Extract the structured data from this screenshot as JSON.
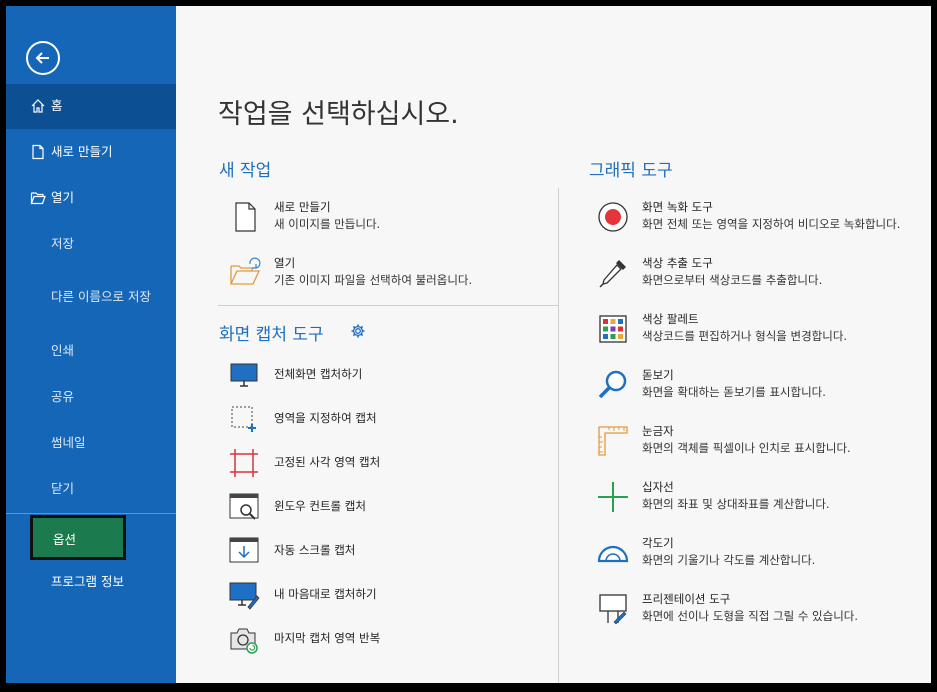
{
  "sidebar": {
    "items": [
      {
        "label": "홈"
      },
      {
        "label": "새로 만들기"
      },
      {
        "label": "열기"
      },
      {
        "label": "저장"
      },
      {
        "label": "다른 이름으로 저장"
      },
      {
        "label": "인쇄"
      },
      {
        "label": "공유"
      },
      {
        "label": "썸네일"
      },
      {
        "label": "닫기"
      },
      {
        "label": "옵션"
      },
      {
        "label": "프로그램 정보"
      }
    ]
  },
  "main": {
    "title": "작업을 선택하십시오.",
    "new_task": {
      "title": "새 작업",
      "items": [
        {
          "title": "새로 만들기",
          "desc": "새 이미지를 만듭니다."
        },
        {
          "title": "열기",
          "desc": "기존 이미지 파일을 선택하여 불러옵니다."
        }
      ]
    },
    "capture": {
      "title": "화면 캡처 도구",
      "items": [
        {
          "label": "전체화면 캡처하기"
        },
        {
          "label": "영역을 지정하여 캡처"
        },
        {
          "label": "고정된 사각 영역 캡처"
        },
        {
          "label": "윈도우 컨트롤 캡처"
        },
        {
          "label": "자동 스크롤 캡처"
        },
        {
          "label": "내 마음대로 캡처하기"
        },
        {
          "label": "마지막 캡처 영역 반복"
        }
      ]
    },
    "graphic": {
      "title": "그래픽 도구",
      "items": [
        {
          "title": "화면 녹화 도구",
          "desc": "화면 전체 또는 영역을 지정하여 비디오로 녹화합니다."
        },
        {
          "title": "색상 추출 도구",
          "desc": "화면으로부터 색상코드를 추출합니다."
        },
        {
          "title": "색상 팔레트",
          "desc": "색상코드를 편집하거나 형식을 변경합니다."
        },
        {
          "title": "돋보기",
          "desc": "화면을 확대하는 돋보기를 표시합니다."
        },
        {
          "title": "눈금자",
          "desc": "화면의 객체를 픽셀이나 인치로 표시합니다."
        },
        {
          "title": "십자선",
          "desc": "화면의 좌표 및 상대좌표를 계산합니다."
        },
        {
          "title": "각도기",
          "desc": "화면의 기울기나 각도를 계산합니다."
        },
        {
          "title": "프리젠테이션 도구",
          "desc": "화면에 선이나 도형을 직접 그릴 수 있습니다."
        }
      ]
    }
  },
  "colors": {
    "sidebar_bg": "#1566b7",
    "sidebar_selected": "#0d4f93",
    "option_bg": "#1c7a4f",
    "accent_text": "#1e6fbe"
  }
}
